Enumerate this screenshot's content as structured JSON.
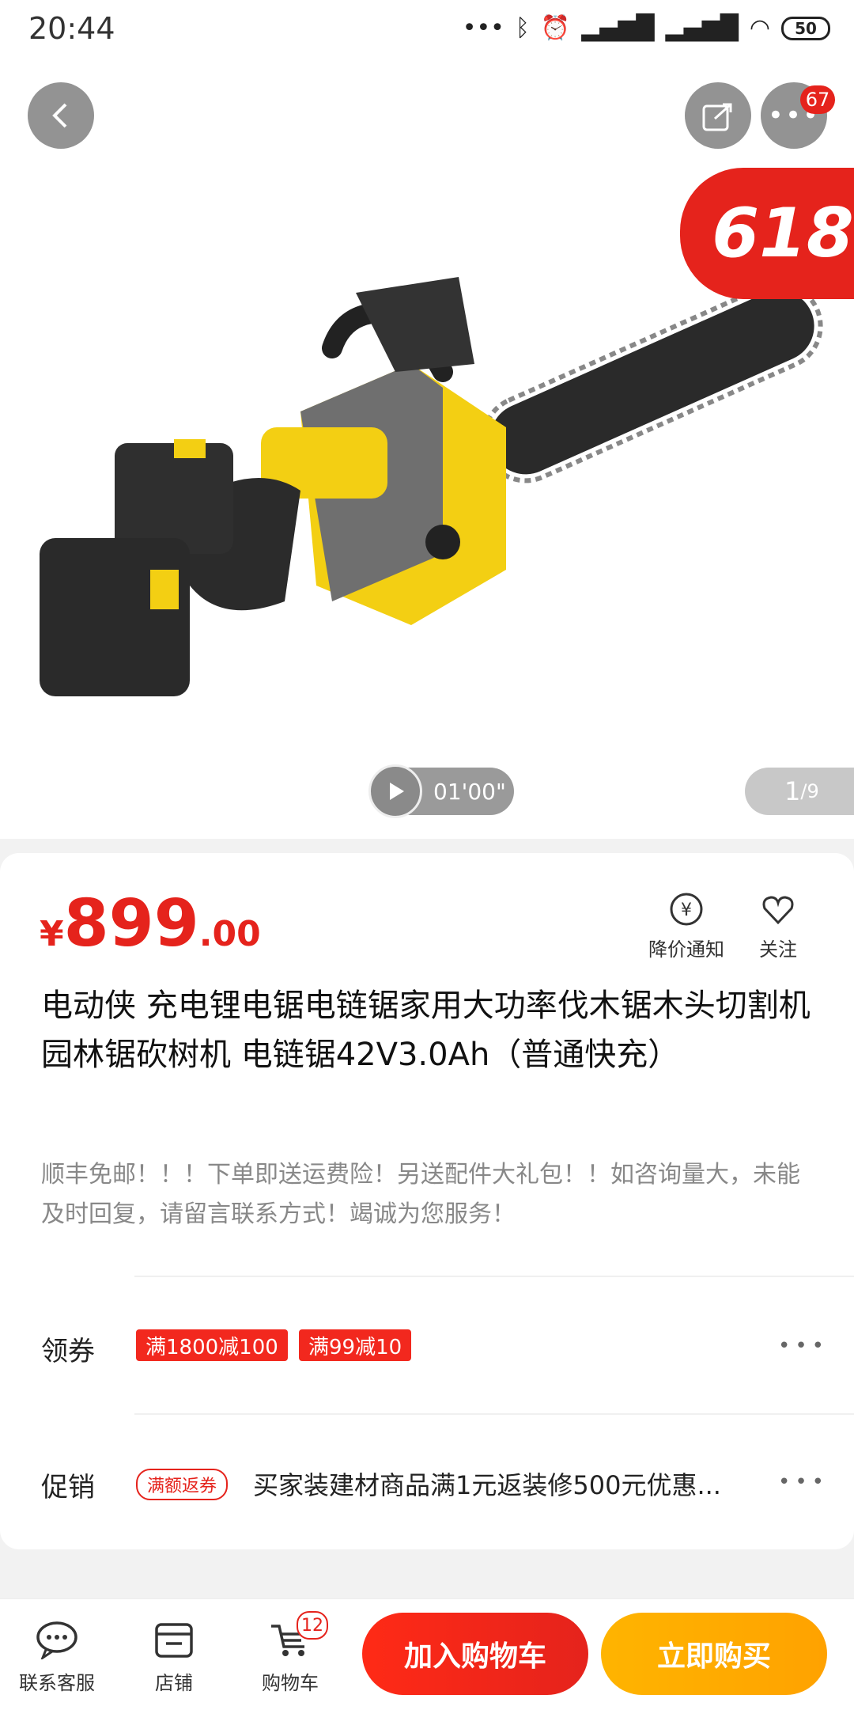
{
  "status_bar": {
    "time": "20:44",
    "battery": "50"
  },
  "header": {
    "message_count": "67",
    "badge_618": "618"
  },
  "media": {
    "video_duration": "01'00\"",
    "pager_current": "1",
    "pager_total": "/9"
  },
  "price": {
    "symbol": "¥",
    "integer": "899",
    "decimal": ".00"
  },
  "actions": {
    "price_alert": "降价通知",
    "follow": "关注"
  },
  "product": {
    "title": "电动侠  充电锂电锯电链锯家用大功率伐木锯木头切割机园林锯砍树机  电链锯42V3.0Ah（普通快充）",
    "subtitle": "顺丰免邮！！！下单即送运费险！另送配件大礼包！！如咨询量大，未能及时回复，请留言联系方式！竭诚为您服务！"
  },
  "coupons": {
    "label": "领券",
    "items": [
      "满1800减100",
      "满99减10"
    ]
  },
  "promotion": {
    "label": "促销",
    "tag": "满额返券",
    "text": "买家装建材商品满1元返装修500元优惠..."
  },
  "bottom_bar": {
    "service": "联系客服",
    "store": "店铺",
    "cart": "购物车",
    "cart_count": "12",
    "add_to_cart": "加入购物车",
    "buy_now": "立即购买"
  },
  "colors": {
    "accent": "#e5231c",
    "orange": "#ffa200"
  }
}
